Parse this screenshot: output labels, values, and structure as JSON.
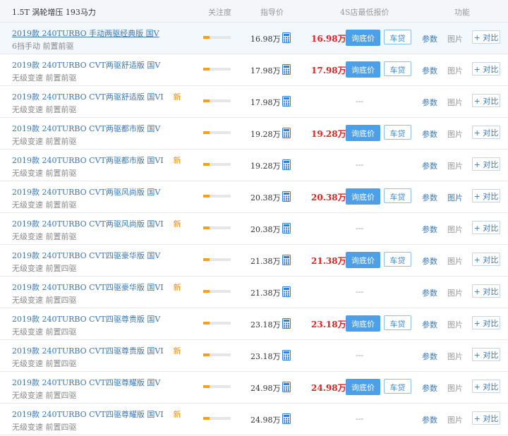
{
  "header": {
    "engine": "1.5T 涡轮增压 193马力",
    "col_attention": "关注度",
    "col_msrp": "指导价",
    "col_dealer": "4S店最低报价",
    "col_functions": "功能"
  },
  "labels": {
    "inquiry": "询底价",
    "loan": "车贷",
    "params": "参数",
    "photos": "图片",
    "compare": "+ 对比",
    "new": "新",
    "no_price": "---"
  },
  "colors": {
    "link": "#3a77b5",
    "price_red": "#e4211e",
    "button_blue": "#4da0e8",
    "attention_orange": "#f2a01e",
    "new_orange": "#ff8a00"
  },
  "rows": [
    {
      "name": "2019款 240TURBO 手动两驱经典版 国V",
      "desc": "6挡手动  前置前驱",
      "msrp": "16.98万",
      "dealer_price": "16.98万",
      "has_price": true,
      "is_new": false,
      "attention": 0.22,
      "active": true,
      "photos_active": false
    },
    {
      "name": "2019款 240TURBO CVT两驱舒适版 国V",
      "desc": "无级变速  前置前驱",
      "msrp": "17.98万",
      "dealer_price": "17.98万",
      "has_price": true,
      "is_new": false,
      "attention": 0.22,
      "active": false,
      "photos_active": false
    },
    {
      "name": "2019款 240TURBO CVT两驱舒适版 国VI",
      "desc": "无级变速  前置前驱",
      "msrp": "17.98万",
      "dealer_price": "",
      "has_price": false,
      "is_new": true,
      "attention": 0.22,
      "active": false,
      "photos_active": false
    },
    {
      "name": "2019款 240TURBO CVT两驱都市版 国V",
      "desc": "无级变速  前置前驱",
      "msrp": "19.28万",
      "dealer_price": "19.28万",
      "has_price": true,
      "is_new": false,
      "attention": 0.22,
      "active": false,
      "photos_active": false
    },
    {
      "name": "2019款 240TURBO CVT两驱都市版 国VI",
      "desc": "无级变速  前置前驱",
      "msrp": "19.28万",
      "dealer_price": "",
      "has_price": false,
      "is_new": true,
      "attention": 0.22,
      "active": false,
      "photos_active": false
    },
    {
      "name": "2019款 240TURBO CVT两驱风尚版 国V",
      "desc": "无级变速  前置前驱",
      "msrp": "20.38万",
      "dealer_price": "20.38万",
      "has_price": true,
      "is_new": false,
      "attention": 0.22,
      "active": false,
      "photos_active": true
    },
    {
      "name": "2019款 240TURBO CVT两驱风尚版 国VI",
      "desc": "无级变速  前置前驱",
      "msrp": "20.38万",
      "dealer_price": "",
      "has_price": false,
      "is_new": true,
      "attention": 0.22,
      "active": false,
      "photos_active": false
    },
    {
      "name": "2019款 240TURBO CVT四驱豪华版 国V",
      "desc": "无级变速  前置四驱",
      "msrp": "21.38万",
      "dealer_price": "21.38万",
      "has_price": true,
      "is_new": false,
      "attention": 0.22,
      "active": false,
      "photos_active": false
    },
    {
      "name": "2019款 240TURBO CVT四驱豪华版 国VI",
      "desc": "无级变速  前置四驱",
      "msrp": "21.38万",
      "dealer_price": "",
      "has_price": false,
      "is_new": true,
      "attention": 0.22,
      "active": false,
      "photos_active": false
    },
    {
      "name": "2019款 240TURBO CVT四驱尊贵版 国V",
      "desc": "无级变速  前置四驱",
      "msrp": "23.18万",
      "dealer_price": "23.18万",
      "has_price": true,
      "is_new": false,
      "attention": 0.22,
      "active": false,
      "photos_active": false
    },
    {
      "name": "2019款 240TURBO CVT四驱尊贵版 国VI",
      "desc": "无级变速  前置四驱",
      "msrp": "23.18万",
      "dealer_price": "",
      "has_price": false,
      "is_new": true,
      "attention": 0.22,
      "active": false,
      "photos_active": false
    },
    {
      "name": "2019款 240TURBO CVT四驱尊耀版 国V",
      "desc": "无级变速  前置四驱",
      "msrp": "24.98万",
      "dealer_price": "24.98万",
      "has_price": true,
      "is_new": false,
      "attention": 0.22,
      "active": false,
      "photos_active": false
    },
    {
      "name": "2019款 240TURBO CVT四驱尊耀版 国VI",
      "desc": "无级变速  前置四驱",
      "msrp": "24.98万",
      "dealer_price": "",
      "has_price": false,
      "is_new": true,
      "attention": 0.22,
      "active": false,
      "photos_active": false
    }
  ]
}
